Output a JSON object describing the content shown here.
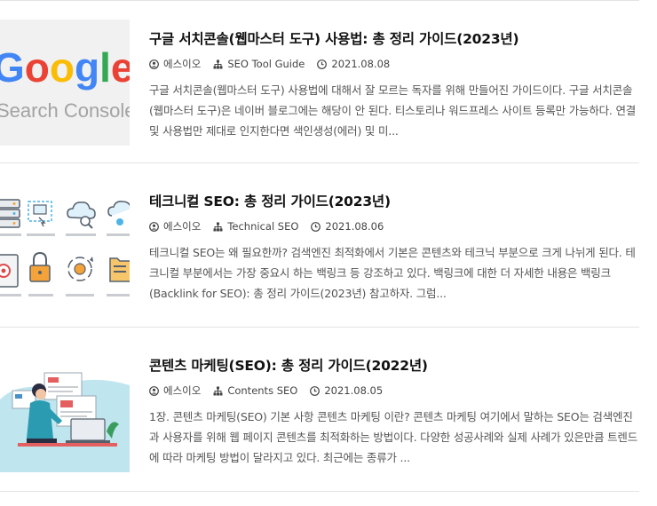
{
  "posts": [
    {
      "title": "구글 서치콘솔(웹마스터 도구) 사용법: 총 정리 가이드(2023년)",
      "author": "에스이오",
      "category": "SEO Tool Guide",
      "date": "2021.08.08",
      "excerpt": "구글 서치콘솔(웹마스터 도구) 사용법에 대해서 잘 모르는 독자를 위해 만들어진 가이드이다. 구글 서치콘솔(웹마스터 도구)은 네이버 블로그에는 해당이 안 된다. 티스토리나 워드프레스 사이트 등록만 가능하다. 연결 및 사용법만 제대로 인지한다면 색인생성(에러) 및 미...",
      "thumbnail": {
        "logo_text": "Google",
        "logo_colors": [
          "#4285F4",
          "#EA4335",
          "#FBBC05",
          "#4285F4",
          "#34A853",
          "#EA4335"
        ],
        "subtext": "Search Console"
      }
    },
    {
      "title": "테크니컬 SEO: 총 정리 가이드(2023년)",
      "author": "에스이오",
      "category": "Technical SEO",
      "date": "2021.08.06",
      "excerpt": "테크니컬 SEO는 왜 필요한까? 검색엔진 최적화에서 기본은 콘텐츠와 테크닉 부분으로 크게 나뉘게 된다. 테크니컬 부분에서는 가장 중요시 하는 백링크 등 강조하고 있다. 백링크에 대한 더 자세한 내용은 백링크(Backlink for SEO): 총 정리 가이드(2023년) 참고하자. 그럼...",
      "thumbnail": {}
    },
    {
      "title": "콘텐츠 마케팅(SEO): 총 정리 가이드(2022년)",
      "author": "에스이오",
      "category": "Contents SEO",
      "date": "2021.08.05",
      "excerpt": "1장. 콘텐츠 마케팅(SEO) 기본 사항 콘텐츠 마케팅 이란? 콘텐츠 마케팅 여기에서 말하는 SEO는 검색엔진과 사용자를 위해 웹 페이지 콘텐츠를 최적화하는 방법이다. 다양한 성공사례와 실제 사례가 있은만큼 트렌드에 따라 마케팅 방법이 달라지고 있다. 최근에는 종류가 ...",
      "thumbnail": {}
    }
  ]
}
